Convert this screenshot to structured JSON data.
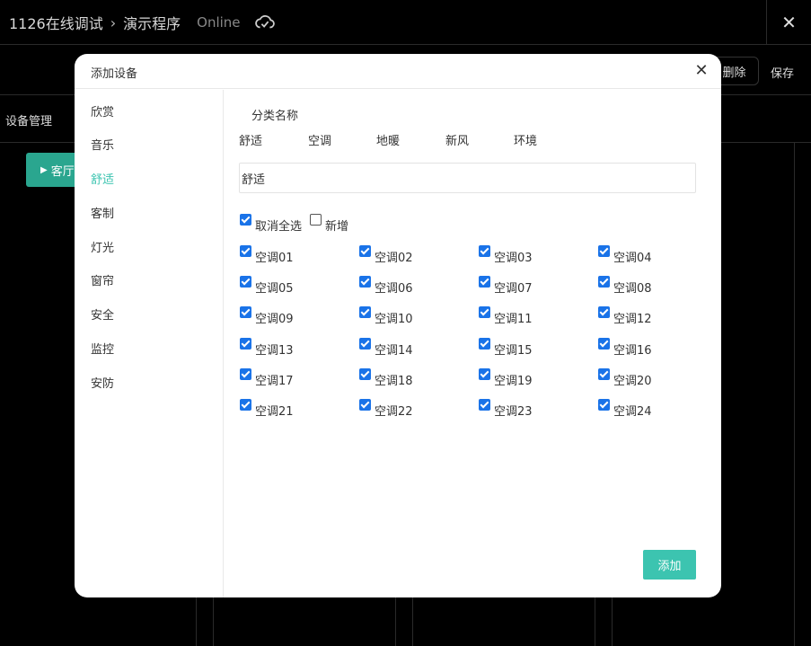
{
  "app": {
    "breadcrumb": [
      "1126在线调试",
      "演示程序"
    ],
    "status": "Online",
    "toolbar": {
      "delete_label": "删除",
      "save_label": "保存"
    },
    "section_title": "设备管理",
    "room_button": "客厅"
  },
  "modal": {
    "title": "添加设备",
    "sidebar": [
      "欣赏",
      "音乐",
      "舒适",
      "客制",
      "灯光",
      "窗帘",
      "安全",
      "监控",
      "安防"
    ],
    "active_item": "舒适",
    "category_title": "分类名称",
    "category_tabs": [
      "舒适",
      "空调",
      "地暖",
      "新风",
      "环境"
    ],
    "name_input_value": "舒适",
    "select_all_label": "取消全选",
    "select_all_checked": true,
    "add_new_label": "新增",
    "add_new_checked": false,
    "devices": [
      "空调01",
      "空调02",
      "空调03",
      "空调04",
      "空调05",
      "空调06",
      "空调07",
      "空调08",
      "空调09",
      "空调10",
      "空调11",
      "空调12",
      "空调13",
      "空调14",
      "空调15",
      "空调16",
      "空调17",
      "空调18",
      "空调19",
      "空调20",
      "空调21",
      "空调22",
      "空调23",
      "空调24"
    ],
    "add_button_label": "添加"
  },
  "colors": {
    "accent": "#3cc4b0",
    "checkbox": "#1a73e8",
    "room_button": "#2aa68f"
  }
}
